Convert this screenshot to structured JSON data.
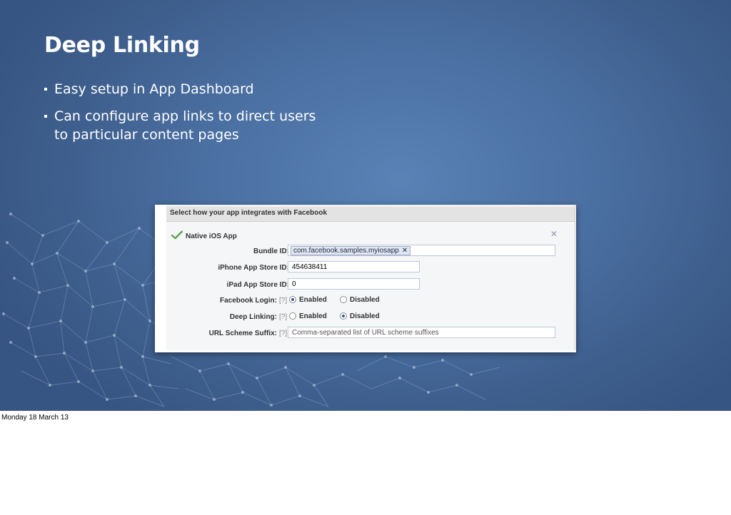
{
  "slide": {
    "title": "Deep Linking",
    "bullets": [
      "Easy setup in App Dashboard",
      "Can configure app links to direct users to particular content pages"
    ]
  },
  "dashboard": {
    "header": "Select how your app integrates with Facebook",
    "app_title": "Native iOS App",
    "close_symbol": "✕",
    "help": "[?]",
    "fields": {
      "bundle_id": {
        "label": "Bundle ID:",
        "token": "com.facebook.samples.myiosapp",
        "token_remove": "✕"
      },
      "iphone_store_id": {
        "label": "iPhone App Store ID:",
        "value": "454638411"
      },
      "ipad_store_id": {
        "label": "iPad App Store ID:",
        "value": "0"
      },
      "facebook_login": {
        "label": "Facebook Login:",
        "options": [
          "Enabled",
          "Disabled"
        ],
        "selected": "Enabled"
      },
      "deep_linking": {
        "label": "Deep Linking:",
        "options": [
          "Enabled",
          "Disabled"
        ],
        "selected": "Disabled"
      },
      "url_scheme_suffix": {
        "label": "URL Scheme Suffix:",
        "placeholder": "Comma-separated list of URL scheme suffixes"
      }
    },
    "icons": {
      "app_status": "checkmark-icon",
      "close": "close-icon"
    },
    "colors": {
      "radio_selected": "#3b5998",
      "check_green": "#4caf50"
    }
  },
  "footer": {
    "date": "Monday 18 March 13"
  }
}
